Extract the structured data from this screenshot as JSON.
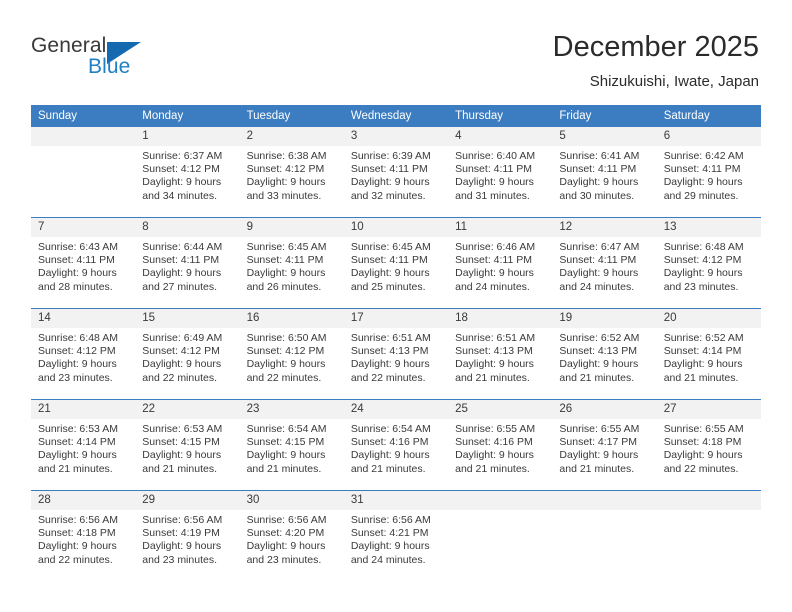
{
  "brand": {
    "name_part1": "General",
    "name_part2": "Blue",
    "accent_color": "#1569ae",
    "text_color": "#3a3a3a"
  },
  "header": {
    "title": "December 2025",
    "subtitle": "Shizukuishi, Iwate, Japan"
  },
  "calendar": {
    "header_bg": "#3b7dc0",
    "daynum_bg": "#f2f2f2",
    "weekday_headers": [
      "Sunday",
      "Monday",
      "Tuesday",
      "Wednesday",
      "Thursday",
      "Friday",
      "Saturday"
    ],
    "weeks": [
      [
        {
          "day": "",
          "sunrise": "",
          "sunset": "",
          "daylight1": "",
          "daylight2": "",
          "blank": true
        },
        {
          "day": "1",
          "sunrise": "Sunrise: 6:37 AM",
          "sunset": "Sunset: 4:12 PM",
          "daylight1": "Daylight: 9 hours",
          "daylight2": "and 34 minutes."
        },
        {
          "day": "2",
          "sunrise": "Sunrise: 6:38 AM",
          "sunset": "Sunset: 4:12 PM",
          "daylight1": "Daylight: 9 hours",
          "daylight2": "and 33 minutes."
        },
        {
          "day": "3",
          "sunrise": "Sunrise: 6:39 AM",
          "sunset": "Sunset: 4:11 PM",
          "daylight1": "Daylight: 9 hours",
          "daylight2": "and 32 minutes."
        },
        {
          "day": "4",
          "sunrise": "Sunrise: 6:40 AM",
          "sunset": "Sunset: 4:11 PM",
          "daylight1": "Daylight: 9 hours",
          "daylight2": "and 31 minutes."
        },
        {
          "day": "5",
          "sunrise": "Sunrise: 6:41 AM",
          "sunset": "Sunset: 4:11 PM",
          "daylight1": "Daylight: 9 hours",
          "daylight2": "and 30 minutes."
        },
        {
          "day": "6",
          "sunrise": "Sunrise: 6:42 AM",
          "sunset": "Sunset: 4:11 PM",
          "daylight1": "Daylight: 9 hours",
          "daylight2": "and 29 minutes."
        }
      ],
      [
        {
          "day": "7",
          "sunrise": "Sunrise: 6:43 AM",
          "sunset": "Sunset: 4:11 PM",
          "daylight1": "Daylight: 9 hours",
          "daylight2": "and 28 minutes."
        },
        {
          "day": "8",
          "sunrise": "Sunrise: 6:44 AM",
          "sunset": "Sunset: 4:11 PM",
          "daylight1": "Daylight: 9 hours",
          "daylight2": "and 27 minutes."
        },
        {
          "day": "9",
          "sunrise": "Sunrise: 6:45 AM",
          "sunset": "Sunset: 4:11 PM",
          "daylight1": "Daylight: 9 hours",
          "daylight2": "and 26 minutes."
        },
        {
          "day": "10",
          "sunrise": "Sunrise: 6:45 AM",
          "sunset": "Sunset: 4:11 PM",
          "daylight1": "Daylight: 9 hours",
          "daylight2": "and 25 minutes."
        },
        {
          "day": "11",
          "sunrise": "Sunrise: 6:46 AM",
          "sunset": "Sunset: 4:11 PM",
          "daylight1": "Daylight: 9 hours",
          "daylight2": "and 24 minutes."
        },
        {
          "day": "12",
          "sunrise": "Sunrise: 6:47 AM",
          "sunset": "Sunset: 4:11 PM",
          "daylight1": "Daylight: 9 hours",
          "daylight2": "and 24 minutes."
        },
        {
          "day": "13",
          "sunrise": "Sunrise: 6:48 AM",
          "sunset": "Sunset: 4:12 PM",
          "daylight1": "Daylight: 9 hours",
          "daylight2": "and 23 minutes."
        }
      ],
      [
        {
          "day": "14",
          "sunrise": "Sunrise: 6:48 AM",
          "sunset": "Sunset: 4:12 PM",
          "daylight1": "Daylight: 9 hours",
          "daylight2": "and 23 minutes."
        },
        {
          "day": "15",
          "sunrise": "Sunrise: 6:49 AM",
          "sunset": "Sunset: 4:12 PM",
          "daylight1": "Daylight: 9 hours",
          "daylight2": "and 22 minutes."
        },
        {
          "day": "16",
          "sunrise": "Sunrise: 6:50 AM",
          "sunset": "Sunset: 4:12 PM",
          "daylight1": "Daylight: 9 hours",
          "daylight2": "and 22 minutes."
        },
        {
          "day": "17",
          "sunrise": "Sunrise: 6:51 AM",
          "sunset": "Sunset: 4:13 PM",
          "daylight1": "Daylight: 9 hours",
          "daylight2": "and 22 minutes."
        },
        {
          "day": "18",
          "sunrise": "Sunrise: 6:51 AM",
          "sunset": "Sunset: 4:13 PM",
          "daylight1": "Daylight: 9 hours",
          "daylight2": "and 21 minutes."
        },
        {
          "day": "19",
          "sunrise": "Sunrise: 6:52 AM",
          "sunset": "Sunset: 4:13 PM",
          "daylight1": "Daylight: 9 hours",
          "daylight2": "and 21 minutes."
        },
        {
          "day": "20",
          "sunrise": "Sunrise: 6:52 AM",
          "sunset": "Sunset: 4:14 PM",
          "daylight1": "Daylight: 9 hours",
          "daylight2": "and 21 minutes."
        }
      ],
      [
        {
          "day": "21",
          "sunrise": "Sunrise: 6:53 AM",
          "sunset": "Sunset: 4:14 PM",
          "daylight1": "Daylight: 9 hours",
          "daylight2": "and 21 minutes."
        },
        {
          "day": "22",
          "sunrise": "Sunrise: 6:53 AM",
          "sunset": "Sunset: 4:15 PM",
          "daylight1": "Daylight: 9 hours",
          "daylight2": "and 21 minutes."
        },
        {
          "day": "23",
          "sunrise": "Sunrise: 6:54 AM",
          "sunset": "Sunset: 4:15 PM",
          "daylight1": "Daylight: 9 hours",
          "daylight2": "and 21 minutes."
        },
        {
          "day": "24",
          "sunrise": "Sunrise: 6:54 AM",
          "sunset": "Sunset: 4:16 PM",
          "daylight1": "Daylight: 9 hours",
          "daylight2": "and 21 minutes."
        },
        {
          "day": "25",
          "sunrise": "Sunrise: 6:55 AM",
          "sunset": "Sunset: 4:16 PM",
          "daylight1": "Daylight: 9 hours",
          "daylight2": "and 21 minutes."
        },
        {
          "day": "26",
          "sunrise": "Sunrise: 6:55 AM",
          "sunset": "Sunset: 4:17 PM",
          "daylight1": "Daylight: 9 hours",
          "daylight2": "and 21 minutes."
        },
        {
          "day": "27",
          "sunrise": "Sunrise: 6:55 AM",
          "sunset": "Sunset: 4:18 PM",
          "daylight1": "Daylight: 9 hours",
          "daylight2": "and 22 minutes."
        }
      ],
      [
        {
          "day": "28",
          "sunrise": "Sunrise: 6:56 AM",
          "sunset": "Sunset: 4:18 PM",
          "daylight1": "Daylight: 9 hours",
          "daylight2": "and 22 minutes."
        },
        {
          "day": "29",
          "sunrise": "Sunrise: 6:56 AM",
          "sunset": "Sunset: 4:19 PM",
          "daylight1": "Daylight: 9 hours",
          "daylight2": "and 23 minutes."
        },
        {
          "day": "30",
          "sunrise": "Sunrise: 6:56 AM",
          "sunset": "Sunset: 4:20 PM",
          "daylight1": "Daylight: 9 hours",
          "daylight2": "and 23 minutes."
        },
        {
          "day": "31",
          "sunrise": "Sunrise: 6:56 AM",
          "sunset": "Sunset: 4:21 PM",
          "daylight1": "Daylight: 9 hours",
          "daylight2": "and 24 minutes."
        },
        {
          "day": "",
          "sunrise": "",
          "sunset": "",
          "daylight1": "",
          "daylight2": "",
          "blank": true
        },
        {
          "day": "",
          "sunrise": "",
          "sunset": "",
          "daylight1": "",
          "daylight2": "",
          "blank": true
        },
        {
          "day": "",
          "sunrise": "",
          "sunset": "",
          "daylight1": "",
          "daylight2": "",
          "blank": true
        }
      ]
    ]
  }
}
